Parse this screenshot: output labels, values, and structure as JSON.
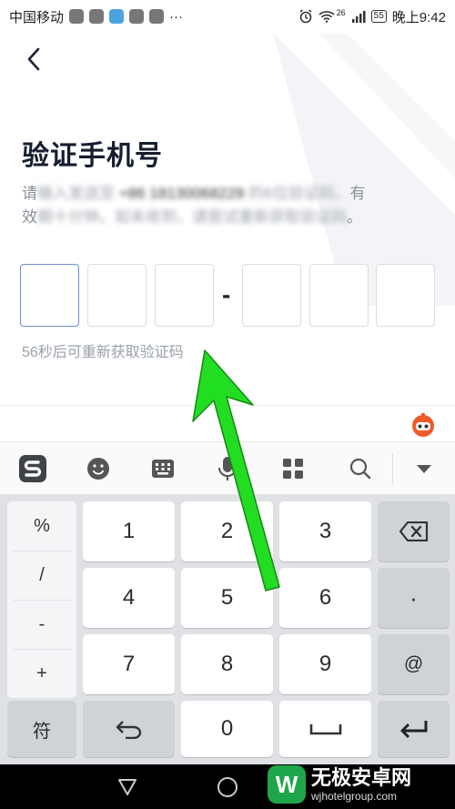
{
  "status_bar": {
    "carrier": "中国移动",
    "overflow": "···",
    "signal_tag": "26",
    "battery": "55",
    "time": "晚上9:42"
  },
  "page": {
    "title": "验证手机号",
    "desc_prefix": "请",
    "desc_blurred_1": "输入发送至",
    "desc_phone_blurred": "+86 18130068229",
    "desc_blurred_2": "的6位验证码，",
    "desc_suffix_1": "有",
    "desc_line2_prefix": "效",
    "desc_blurred_3": "期十分钟。如未收到，请尝试重新获取验证码",
    "desc_suffix_2": "。",
    "code_dash": "-",
    "resend_text": "56秒后可重新获取验证码"
  },
  "keyboard": {
    "symbols": [
      "%",
      "/",
      "-",
      "+"
    ],
    "keys": [
      "1",
      "2",
      "3",
      "4",
      "5",
      "6",
      "7",
      "8",
      "9",
      "0"
    ],
    "dot": "·",
    "at": "@",
    "symbols_key": "符"
  },
  "watermark": {
    "logo": "W",
    "title": "无极安卓网",
    "url": "wjhotelgroup.com"
  },
  "colors": {
    "accent_box": "#6b8fd6",
    "arrow": "#22dd22",
    "keyboard_bg": "#dfe1e5"
  }
}
